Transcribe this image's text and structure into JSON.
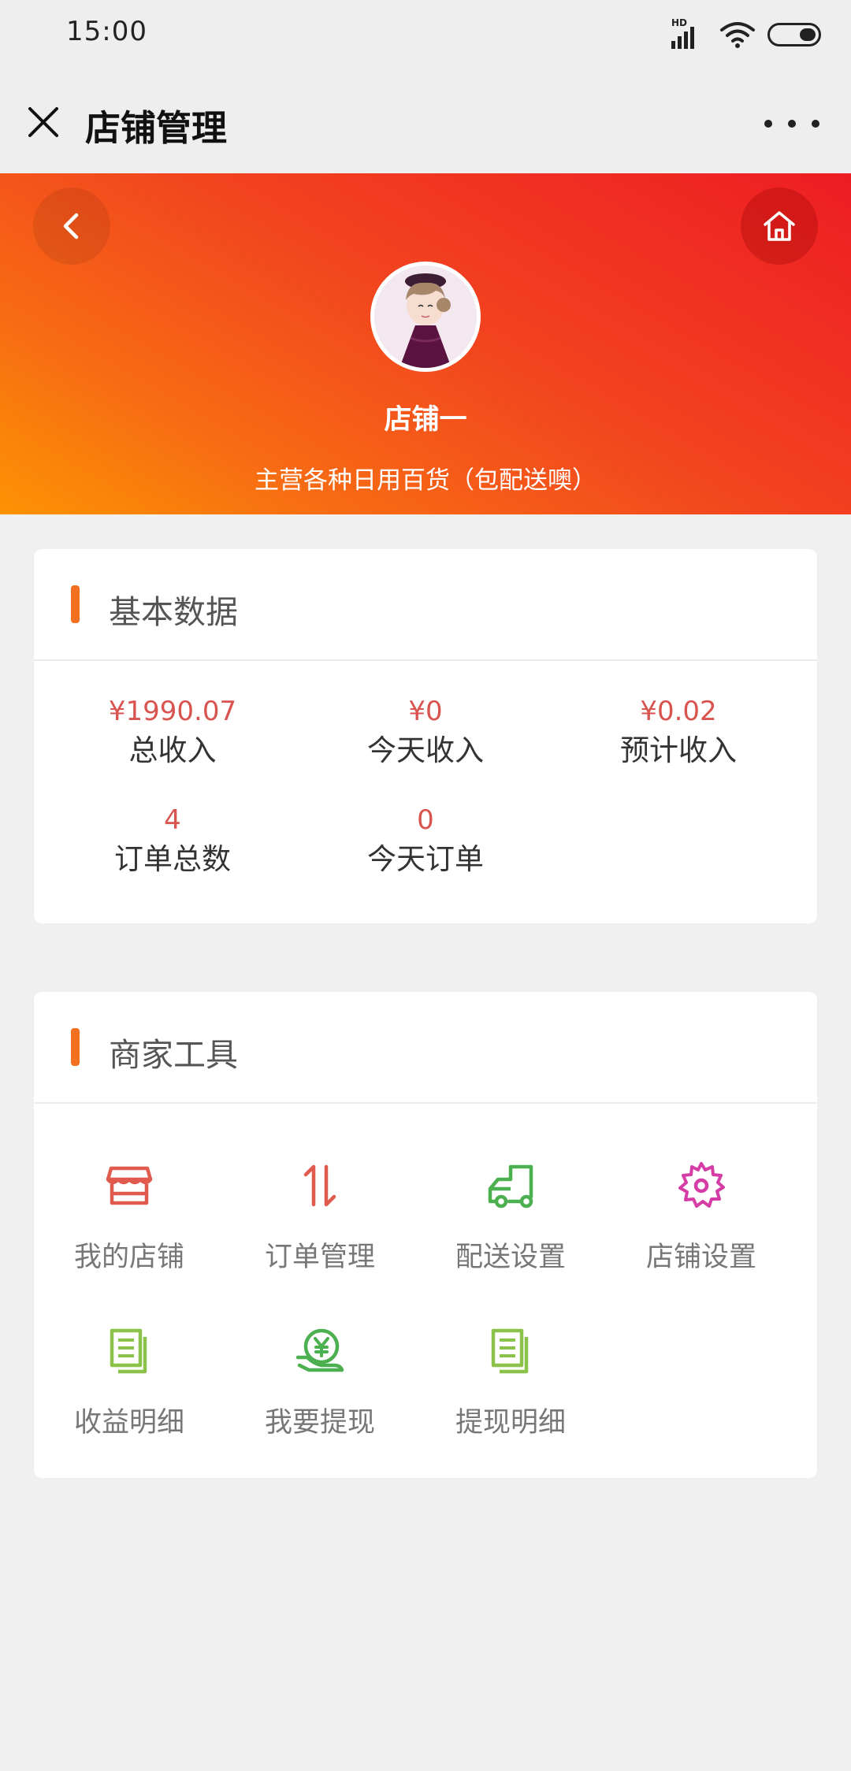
{
  "status_bar": {
    "time": "15:00",
    "network_label": "HD"
  },
  "nav": {
    "title": "店铺管理"
  },
  "shop": {
    "name": "店铺一",
    "description": "主营各种日用百货（包配送噢）"
  },
  "basic_data": {
    "title": "基本数据",
    "stats": [
      {
        "value": "¥1990.07",
        "label": "总收入"
      },
      {
        "value": "¥0",
        "label": "今天收入"
      },
      {
        "value": "¥0.02",
        "label": "预计收入"
      },
      {
        "value": "4",
        "label": "订单总数"
      },
      {
        "value": "0",
        "label": "今天订单"
      }
    ]
  },
  "merchant_tools": {
    "title": "商家工具",
    "items": [
      {
        "label": "我的店铺",
        "icon": "store-icon",
        "color": "#e05a4e"
      },
      {
        "label": "订单管理",
        "icon": "sort-arrows-icon",
        "color": "#e05a4e"
      },
      {
        "label": "配送设置",
        "icon": "delivery-truck-icon",
        "color": "#4caf50"
      },
      {
        "label": "店铺设置",
        "icon": "gear-icon",
        "color": "#d63ca6"
      },
      {
        "label": "收益明细",
        "icon": "document-list-icon",
        "color": "#8bc34a"
      },
      {
        "label": "我要提现",
        "icon": "withdraw-yen-icon",
        "color": "#4caf50"
      },
      {
        "label": "提现明细",
        "icon": "document-list-icon",
        "color": "#8bc34a"
      }
    ]
  },
  "colors": {
    "accent": "#f37021",
    "value_red": "#d9534f",
    "hero_start": "#fd9303",
    "hero_end": "#ee1c24"
  }
}
